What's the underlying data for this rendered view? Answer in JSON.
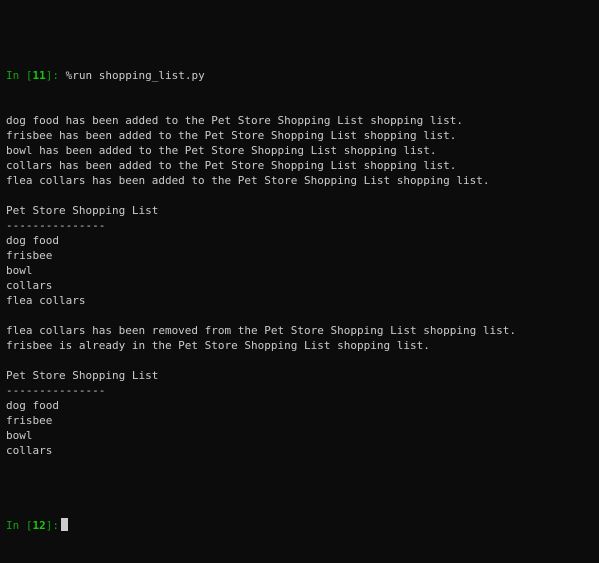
{
  "colors": {
    "background": "#0c0c0c",
    "text": "#cccccc",
    "prompt": "#13a10e",
    "prompt_number": "#16c60c"
  },
  "session": {
    "prompt1": {
      "label": "In [",
      "number": "11",
      "close": "]:",
      "command": " %run shopping_list.py"
    },
    "prompt2": {
      "label": "In [",
      "number": "12",
      "close": "]:"
    },
    "output": [
      "dog food has been added to the Pet Store Shopping List shopping list.",
      "frisbee has been added to the Pet Store Shopping List shopping list.",
      "bowl has been added to the Pet Store Shopping List shopping list.",
      "collars has been added to the Pet Store Shopping List shopping list.",
      "flea collars has been added to the Pet Store Shopping List shopping list.",
      "",
      "Pet Store Shopping List",
      "---------------",
      "dog food",
      "frisbee",
      "bowl",
      "collars",
      "flea collars",
      "",
      "flea collars has been removed from the Pet Store Shopping List shopping list.",
      "frisbee is already in the Pet Store Shopping List shopping list.",
      "",
      "Pet Store Shopping List",
      "---------------",
      "dog food",
      "frisbee",
      "bowl",
      "collars",
      "",
      ""
    ]
  }
}
